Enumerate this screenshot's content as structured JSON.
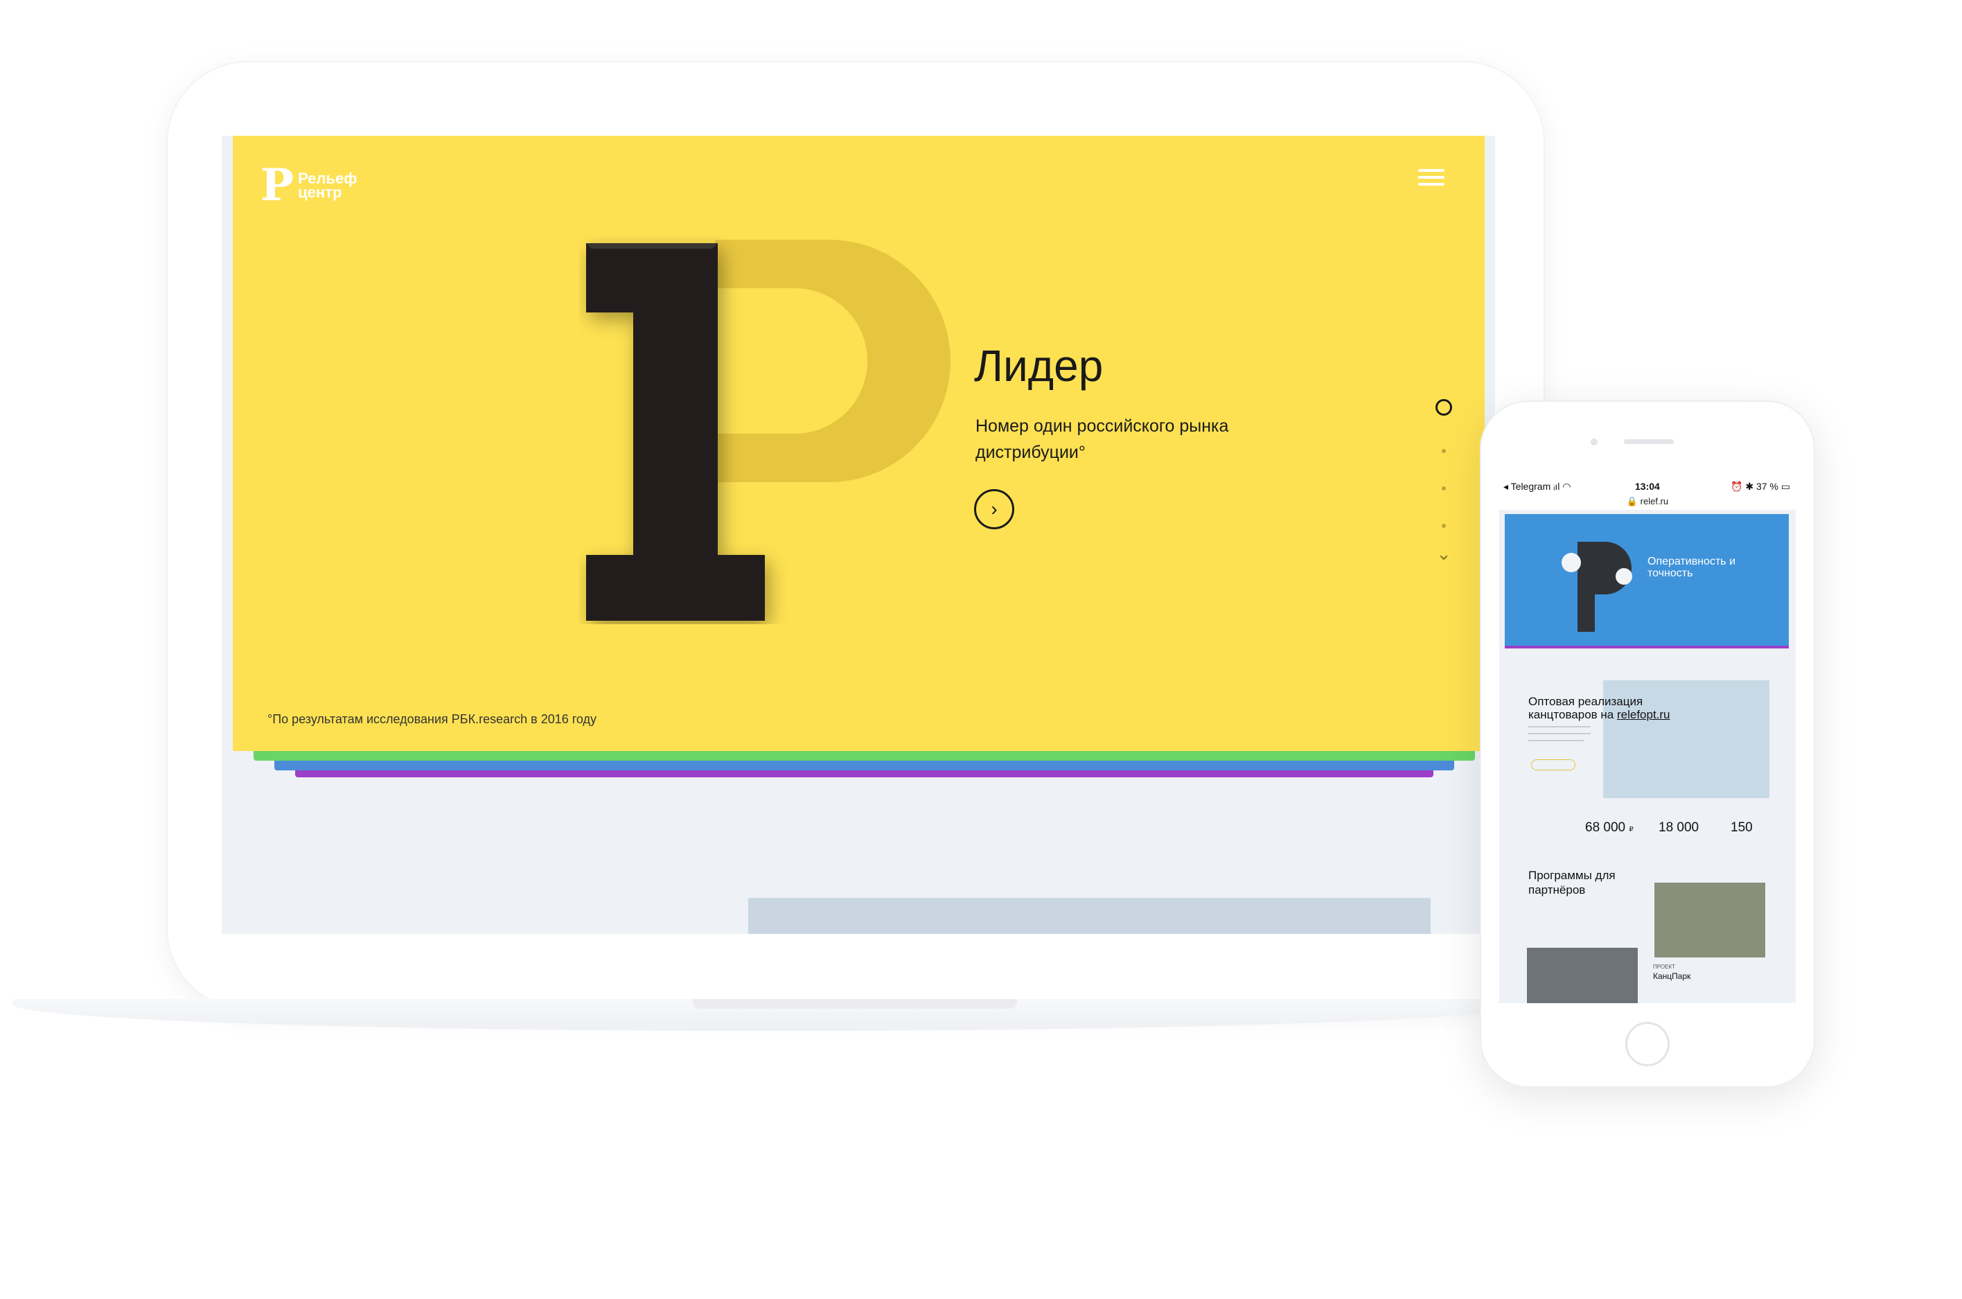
{
  "desktop": {
    "logo_mark": "P",
    "logo_text": "Рельеф центр",
    "hero": {
      "title": "Лидер",
      "subtitle": "Номер один российского рынка дистрибуции°",
      "footnote": "°По результатам исследования РБК.research в 2016 году",
      "next_icon": "›"
    },
    "pager": {
      "down_icon": "⌄"
    },
    "colors": {
      "hero_bg": "#fee152",
      "stripe_green": "#69d566",
      "stripe_blue": "#4b8bd9",
      "stripe_purple": "#9c3fc9"
    }
  },
  "phone": {
    "status": {
      "left": "◂ Telegram ᵢıl ◠",
      "time": "13:04",
      "right": "⏰ ✱ 37 % ▭"
    },
    "url": "🔒 relef.ru",
    "hero_title": "Оперативность и точность",
    "section1": {
      "title_prefix": "Оптовая реализация канцтоваров на ",
      "title_link": "relefopt.ru"
    },
    "stats": [
      {
        "value": "68 000",
        "unit": "₽"
      },
      {
        "value": "18 000"
      },
      {
        "value": "150"
      }
    ],
    "section2_title": "Программы для партнёров",
    "project_label": "ПРОЕКТ",
    "project_name": "КанцПарк"
  }
}
